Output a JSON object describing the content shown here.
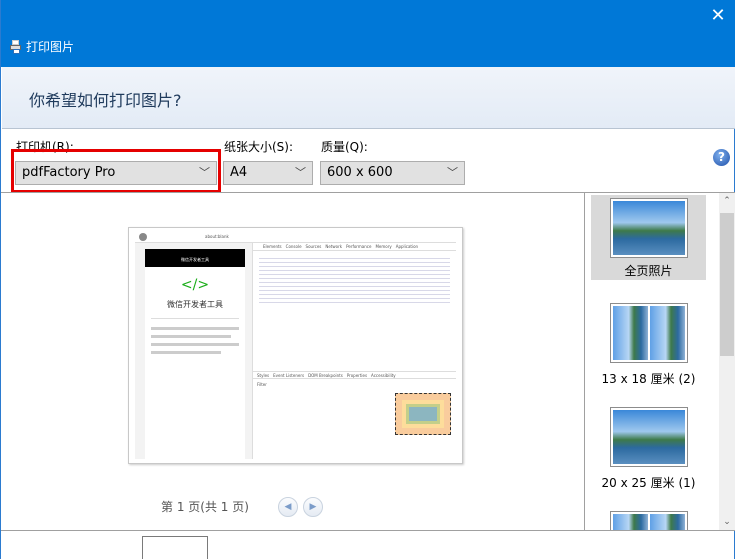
{
  "window": {
    "title": "打印图片",
    "close_icon": "close-icon"
  },
  "header": {
    "question": "你希望如何打印图片?"
  },
  "printer": {
    "label": "打印机(R):",
    "value": "pdfFactory Pro"
  },
  "paper": {
    "label": "纸张大小(S):",
    "value": "A4"
  },
  "quality": {
    "label": "质量(Q):",
    "value": "600 x 600"
  },
  "help": "?",
  "preview": {
    "url": "about:blank",
    "app_title": "微信开发者工具",
    "logo": "</>",
    "devtools_tabs": [
      "Elements",
      "Console",
      "Sources",
      "Network",
      "Performance",
      "Memory",
      "Application"
    ],
    "styles_tabs": [
      "Styles",
      "Event Listeners",
      "DOM Breakpoints",
      "Properties",
      "Accessibility"
    ],
    "filter": "Filter"
  },
  "pagination": {
    "text": "第 1 页(共 1 页)",
    "prev": "◀",
    "next": "▶"
  },
  "layouts": [
    {
      "label": "全页照片",
      "selected": true
    },
    {
      "label": "13 x 18 厘米 (2)",
      "selected": false
    },
    {
      "label": "20 x 25 厘米 (1)",
      "selected": false
    },
    {
      "label": "",
      "selected": false
    }
  ],
  "colors": {
    "titlebar": "#0078d7",
    "highlight": "#e50000"
  }
}
